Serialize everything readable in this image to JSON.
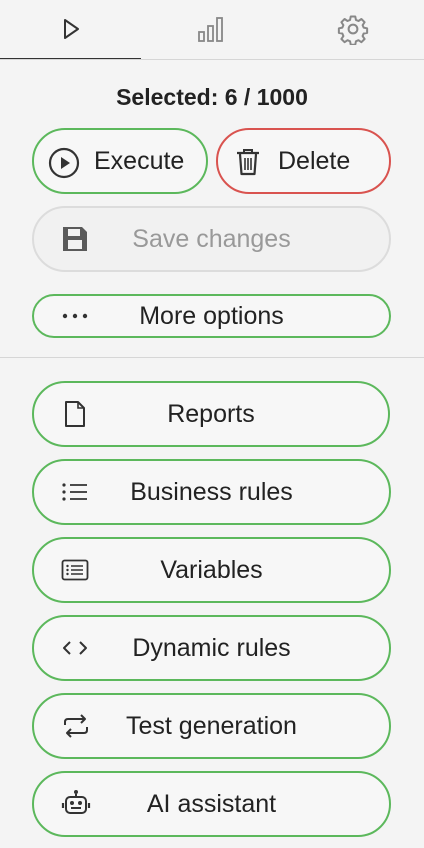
{
  "tabs": [
    {
      "name": "run",
      "icon": "play-icon"
    },
    {
      "name": "stats",
      "icon": "bar-chart-icon"
    },
    {
      "name": "settings",
      "icon": "gear-icon"
    }
  ],
  "selection": {
    "text": "Selected: 6 / 1000"
  },
  "actions": {
    "execute": {
      "label": "Execute",
      "icon": "play-circle-icon"
    },
    "delete": {
      "label": "Delete",
      "icon": "trash-icon"
    },
    "save": {
      "label": "Save changes",
      "icon": "save-icon",
      "disabled": true
    },
    "more": {
      "label": "More options",
      "icon": "more-horizontal-icon"
    }
  },
  "menu": {
    "items": [
      {
        "label": "Reports",
        "icon": "document-icon"
      },
      {
        "label": "Business rules",
        "icon": "list-icon"
      },
      {
        "label": "Variables",
        "icon": "list-box-icon"
      },
      {
        "label": "Dynamic rules",
        "icon": "code-icon"
      },
      {
        "label": "Test generation",
        "icon": "repeat-icon"
      },
      {
        "label": "AI assistant",
        "icon": "robot-icon"
      }
    ]
  },
  "colors": {
    "accent_green": "#5cb85c",
    "danger_red": "#d9534f",
    "disabled_gray": "#dcdcdc",
    "background": "#f4f4f4"
  }
}
